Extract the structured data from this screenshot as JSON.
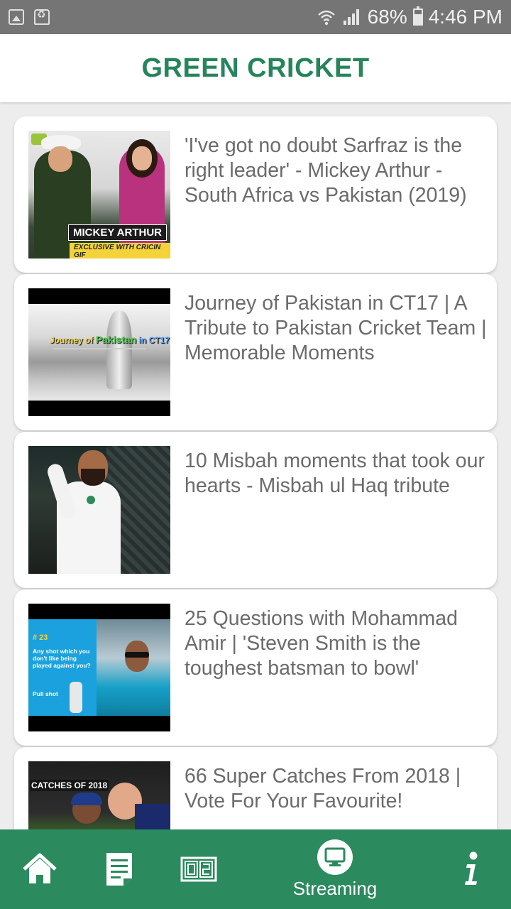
{
  "status_bar": {
    "battery": "68%",
    "time": "4:46 PM",
    "icons": [
      "gallery-notification-icon",
      "recycle-notification-icon",
      "wifi-icon",
      "signal-icon",
      "battery-icon"
    ]
  },
  "app": {
    "title": "GREEN CRICKET",
    "accent_color": "#26855b",
    "nav_color": "#2b8a5e"
  },
  "videos": [
    {
      "title": "'I've got no doubt Sarfraz is the right leader' - Mickey Arthur - South Africa vs Pakistan (2019)",
      "thumb_text": "MICKEY ARTHUR",
      "thumb_sub": "EXCLUSIVE WITH CRICIN GIF"
    },
    {
      "title": "Journey of Pakistan in CT17 | A Tribute to Pakistan Cricket Team | Memorable Moments",
      "thumb_text_a": "Journey of ",
      "thumb_text_b": "Pakistan",
      "thumb_text_c": " in CT17"
    },
    {
      "title": "10 Misbah moments that took our hearts - Misbah ul Haq tribute"
    },
    {
      "title": "25 Questions with Mohammad Amir | 'Steven Smith is the toughest batsman to bowl'",
      "thumb_num": "# 23",
      "thumb_q": "Any shot which you don't like being played against you?",
      "thumb_shot": "Pull shot"
    },
    {
      "title": "66 Super Catches From 2018 | Vote For Your Favourite!",
      "thumb_text": "CATCHES OF 2018"
    }
  ],
  "bottom_nav": {
    "items": [
      {
        "icon": "home-icon",
        "label": ""
      },
      {
        "icon": "news-icon",
        "label": ""
      },
      {
        "icon": "scoreboard-icon",
        "label": ""
      },
      {
        "icon": "streaming-icon",
        "label": "Streaming"
      },
      {
        "icon": "info-icon",
        "label": ""
      }
    ],
    "active": "Streaming"
  }
}
